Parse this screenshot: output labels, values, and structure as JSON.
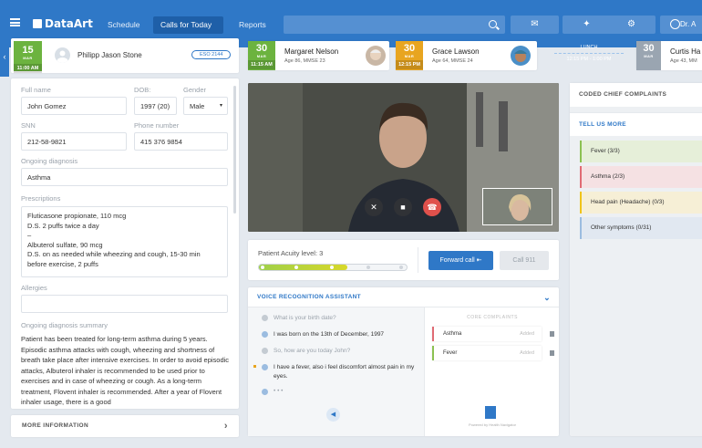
{
  "nav": {
    "logo": "DataArt",
    "schedule": "Schedule",
    "calls_today": "Calls for Today",
    "reports": "Reports",
    "user": "Dr. A",
    "search_placeholder": ""
  },
  "current_patient": {
    "day": "15",
    "month": "MAR",
    "time": "11:00 AM",
    "name": "Philipp Jason Stone",
    "badge": "ESO 2144"
  },
  "queue": [
    {
      "day": "30",
      "month": "MAR",
      "time": "11:15 AM",
      "name": "Margaret Nelson",
      "info": "Age 86, MMSE 23",
      "color": "#6cb33f"
    },
    {
      "day": "30",
      "month": "MAR",
      "time": "12:15 PM",
      "name": "Grace Lawson",
      "info": "Age 64, MMSE 24",
      "color": "#e8a520"
    },
    {
      "day": "30",
      "month": "MAR",
      "time": "",
      "name": "Curtis Ha",
      "info": "Age 43, MM",
      "color": "#9aa5b1"
    }
  ],
  "lunch": {
    "label": "LUNCH",
    "time": "12:15 PM - 1:00 PM"
  },
  "form": {
    "fullname_label": "Full name",
    "fullname": "John Gomez",
    "dob_label": "DOB:",
    "dob": "1997 (20)",
    "gender_label": "Gender",
    "gender": "Male",
    "ssn_label": "SNN",
    "ssn": "212-58-9821",
    "phone_label": "Phone number",
    "phone": "415 376 9854",
    "diag_label": "Ongoing diagnosis",
    "diag": "Asthma",
    "presc_label": "Prescriptions",
    "presc": [
      "Fluticasone propionate, 110 mcg",
      "D.S. 2 puffs twice a day",
      "–",
      "Albuterol sulfate, 90 mcg",
      "D.S. on as needed while wheezing and cough, 15-30 min before exercise, 2 puffs"
    ],
    "allergies_label": "Allergies",
    "allergies": "",
    "summary_label": "Ongoing diagnosis summary",
    "summary": "Patient has been treated for long-term asthma during 5 years. Episodic asthma attacks with cough, wheezing and shortness of breath take place after intensive exercises. In order to avoid episodic attacks, Albuterol inhaler is recommended to be used prior to exercises and in case of wheezing or cough. As a long-term treatment, Flovent inhaler is recommended. After a year of Flovent inhaler usage, there is a good"
  },
  "more_info": "MORE INFORMATION",
  "acuity": {
    "label": "Patient Acuity level: 3",
    "level": 3,
    "max": 5,
    "forward": "Forward call",
    "call911": "Call 911"
  },
  "var": {
    "title": "VOICE RECOGNITION ASSISTANT",
    "messages": [
      "What is your birth date?",
      "I was born on the 13th of December, 1997",
      "So, how are you today John?",
      "I have a fever, also i feel discomfort almost pain in my eyes.",
      "• • •"
    ],
    "complaints_title": "CORE COMPLAINTS",
    "complaints": [
      {
        "name": "Asthma",
        "status": "Added"
      },
      {
        "name": "Fever",
        "status": "Added"
      }
    ],
    "footer": "Powered by Health Navigator"
  },
  "right": {
    "coded": "CODED CHIEF COMPLAINTS",
    "tell": "TELL US MORE",
    "symptoms": [
      {
        "label": "Fever (3/3)",
        "color": "#8cc152",
        "bg": "#e6efd9"
      },
      {
        "label": "Asthma (2/3)",
        "color": "#e06b74",
        "bg": "#f5e1e3"
      },
      {
        "label": "Head pain (Headache) (0/3)",
        "color": "#f0c419",
        "bg": "#f6efd6"
      },
      {
        "label": "Other symptoms (0/31)",
        "color": "#9bbce0",
        "bg": "#e1e8f1"
      }
    ]
  }
}
